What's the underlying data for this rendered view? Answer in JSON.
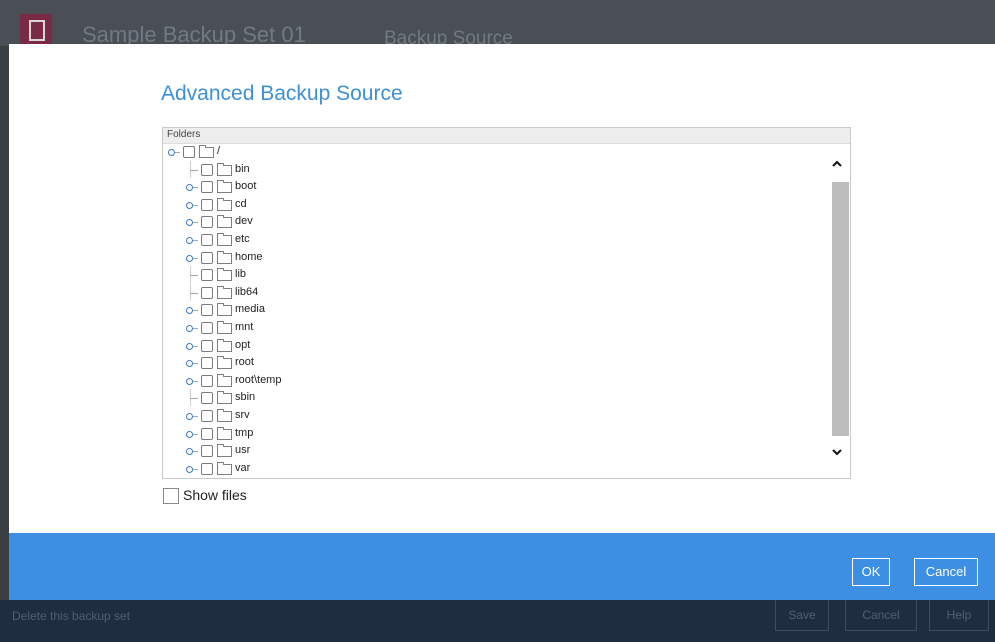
{
  "background": {
    "app_title": "Sample Backup Set 01",
    "section_title": "Backup Source",
    "footer": {
      "delete_label": "Delete this backup set",
      "save_label": "Save",
      "cancel_label": "Cancel",
      "help_label": "Help"
    }
  },
  "dialog": {
    "title": "Advanced Backup Source",
    "tree": {
      "header": "Folders",
      "root": {
        "label": "/",
        "checked": false,
        "expanded": true
      },
      "items": [
        {
          "label": "bin",
          "expandable": false,
          "checked": false
        },
        {
          "label": "boot",
          "expandable": true,
          "checked": false
        },
        {
          "label": "cd",
          "expandable": true,
          "checked": false
        },
        {
          "label": "dev",
          "expandable": true,
          "checked": false
        },
        {
          "label": "etc",
          "expandable": true,
          "checked": false
        },
        {
          "label": "home",
          "expandable": true,
          "checked": false
        },
        {
          "label": "lib",
          "expandable": false,
          "checked": false
        },
        {
          "label": "lib64",
          "expandable": false,
          "checked": false
        },
        {
          "label": "media",
          "expandable": true,
          "checked": false
        },
        {
          "label": "mnt",
          "expandable": true,
          "checked": false
        },
        {
          "label": "opt",
          "expandable": true,
          "checked": false
        },
        {
          "label": "root",
          "expandable": true,
          "checked": false
        },
        {
          "label": "root\\temp",
          "expandable": true,
          "checked": false
        },
        {
          "label": "sbin",
          "expandable": false,
          "checked": false
        },
        {
          "label": "srv",
          "expandable": true,
          "checked": false
        },
        {
          "label": "tmp",
          "expandable": true,
          "checked": false
        },
        {
          "label": "usr",
          "expandable": true,
          "checked": false
        },
        {
          "label": "var",
          "expandable": true,
          "checked": false
        }
      ]
    },
    "show_files": {
      "label": "Show files",
      "checked": false
    },
    "buttons": {
      "ok_label": "OK",
      "cancel_label": "Cancel"
    }
  },
  "colors": {
    "accent": "#3d8fe3",
    "title": "#3d8fd6",
    "background_footer": "#1e2d3f"
  },
  "icons": [
    "folder-icon",
    "checkbox-icon",
    "tree-expander-icon",
    "chevron-up-icon",
    "chevron-down-icon"
  ]
}
